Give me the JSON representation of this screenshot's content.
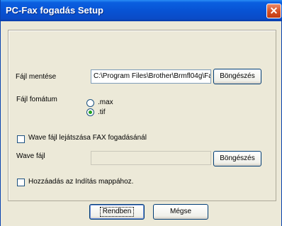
{
  "window": {
    "title": "PC-Fax fogadás Setup",
    "close_glyph": "✕"
  },
  "save": {
    "label": "Fájl mentése",
    "path_value": "C:\\Program Files\\Brother\\Brmfl04g\\Fa",
    "browse_label": "Böngészés"
  },
  "format": {
    "label": "Fájl fomátum",
    "options": [
      {
        "label": ".max",
        "selected": false
      },
      {
        "label": ".tif",
        "selected": true
      }
    ]
  },
  "wave_play": {
    "label": "Wave fájl lejátszása FAX fogadásánál",
    "checked": false
  },
  "wave_file": {
    "label": "Wave fájl",
    "value": "",
    "browse_label": "Böngészés"
  },
  "startup": {
    "label": "Hozzáadás az Indítás mappához.",
    "checked": false
  },
  "footer": {
    "ok_label": "Rendben",
    "cancel_label": "Mégse"
  },
  "colors": {
    "titlebar": "#0853d4",
    "dialog_bg": "#ece9d8",
    "close_button": "#d54f22"
  }
}
